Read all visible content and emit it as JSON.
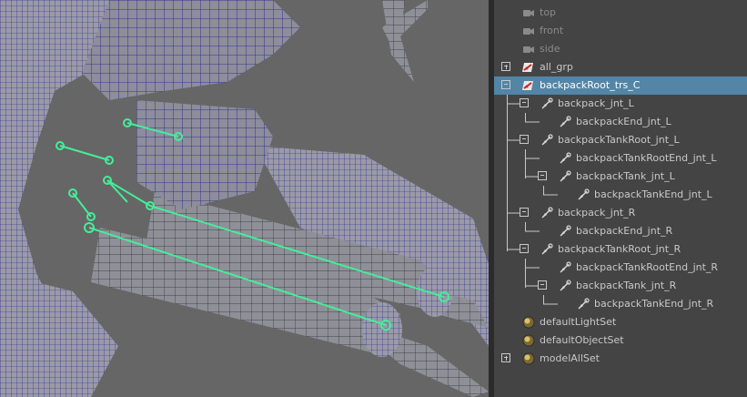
{
  "outliner": {
    "items": [
      {
        "label": "top",
        "icon": "camera-icon",
        "depth": 0,
        "expander": "none",
        "dim": true
      },
      {
        "label": "front",
        "icon": "camera-icon",
        "depth": 0,
        "expander": "none",
        "dim": true
      },
      {
        "label": "side",
        "icon": "camera-icon",
        "depth": 0,
        "expander": "none",
        "dim": true
      },
      {
        "label": "all_grp",
        "icon": "group-transform-icon",
        "depth": 0,
        "expander": "plus",
        "dim": false
      },
      {
        "label": "backpackRoot_trs_C",
        "icon": "group-transform-icon",
        "depth": 0,
        "expander": "minus",
        "dim": false,
        "selected": true
      },
      {
        "label": "backpack_jnt_L",
        "icon": "joint-icon",
        "depth": 1,
        "expander": "minus",
        "dim": false
      },
      {
        "label": "backpackEnd_jnt_L",
        "icon": "joint-icon",
        "depth": 2,
        "expander": "none",
        "dim": false
      },
      {
        "label": "backpackTankRoot_jnt_L",
        "icon": "joint-icon",
        "depth": 1,
        "expander": "minus",
        "dim": false
      },
      {
        "label": "backpackTankRootEnd_jnt_L",
        "icon": "joint-icon",
        "depth": 2,
        "expander": "none",
        "dim": false
      },
      {
        "label": "backpackTank_jnt_L",
        "icon": "joint-icon",
        "depth": 2,
        "expander": "minus",
        "dim": false
      },
      {
        "label": "backpackTankEnd_jnt_L",
        "icon": "joint-icon",
        "depth": 3,
        "expander": "none",
        "dim": false
      },
      {
        "label": "backpack_jnt_R",
        "icon": "joint-icon",
        "depth": 1,
        "expander": "minus",
        "dim": false
      },
      {
        "label": "backpackEnd_jnt_R",
        "icon": "joint-icon",
        "depth": 2,
        "expander": "none",
        "dim": false
      },
      {
        "label": "backpackTankRoot_jnt_R",
        "icon": "joint-icon",
        "depth": 1,
        "expander": "minus",
        "dim": false
      },
      {
        "label": "backpackTankRootEnd_jnt_R",
        "icon": "joint-icon",
        "depth": 2,
        "expander": "none",
        "dim": false
      },
      {
        "label": "backpackTank_jnt_R",
        "icon": "joint-icon",
        "depth": 2,
        "expander": "minus",
        "dim": false
      },
      {
        "label": "backpackTankEnd_jnt_R",
        "icon": "joint-icon",
        "depth": 3,
        "expander": "none",
        "dim": false
      },
      {
        "label": "defaultLightSet",
        "icon": "set-sphere-icon",
        "depth": 0,
        "expander": "none",
        "dim": false
      },
      {
        "label": "defaultObjectSet",
        "icon": "set-sphere-icon",
        "depth": 0,
        "expander": "none",
        "dim": false
      },
      {
        "label": "modelAllSet",
        "icon": "set-sphere-icon",
        "depth": 0,
        "expander": "plus",
        "dim": false
      }
    ]
  },
  "colors": {
    "selection": "#5285a6",
    "joint": "#44ee99",
    "wire": "#1a1a8c",
    "shading": "#8a8a9a"
  }
}
